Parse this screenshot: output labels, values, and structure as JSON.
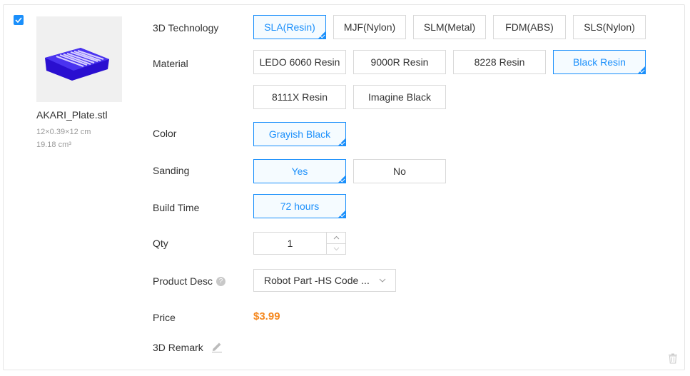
{
  "file": {
    "name": "AKARI_Plate.stl",
    "dimensions": "12×0.39×12 cm",
    "volume": "19.18 cm³"
  },
  "technology": {
    "label": "3D Technology",
    "options": [
      "SLA(Resin)",
      "MJF(Nylon)",
      "SLM(Metal)",
      "FDM(ABS)",
      "SLS(Nylon)"
    ],
    "selected": "SLA(Resin)"
  },
  "material": {
    "label": "Material",
    "options": [
      "LEDO 6060 Resin",
      "9000R Resin",
      "8228 Resin",
      "Black Resin",
      "8111X Resin",
      "Imagine Black"
    ],
    "selected": "Black Resin"
  },
  "color": {
    "label": "Color",
    "options": [
      "Grayish Black"
    ],
    "selected": "Grayish Black"
  },
  "sanding": {
    "label": "Sanding",
    "options": [
      "Yes",
      "No"
    ],
    "selected": "Yes"
  },
  "build_time": {
    "label": "Build Time",
    "options": [
      "72 hours"
    ],
    "selected": "72 hours"
  },
  "qty": {
    "label": "Qty",
    "value": "1"
  },
  "product_desc": {
    "label": "Product Desc",
    "value": "Robot Part -HS Code ..."
  },
  "price": {
    "label": "Price",
    "value": "$3.99"
  },
  "remark": {
    "label": "3D Remark"
  },
  "colors": {
    "accent": "#1a8ffb",
    "price": "#f5881f",
    "model": "#3a1fe0"
  }
}
